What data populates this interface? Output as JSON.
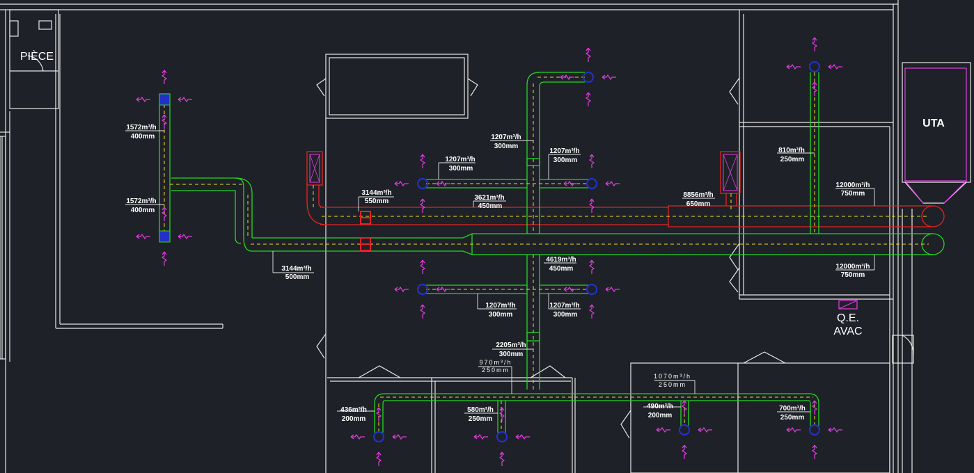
{
  "rooms": {
    "piece": "PIÈCE",
    "uta": "UTA",
    "qe_line1": "Q.E.",
    "qe_line2": "AVAC"
  },
  "labels": [
    {
      "flow": "1572m³/h",
      "size": "400mm"
    },
    {
      "flow": "1572m³/h",
      "size": "400mm"
    },
    {
      "flow": "1207m³/h",
      "size": "300mm"
    },
    {
      "flow": "1207m³/h",
      "size": "300mm"
    },
    {
      "flow": "1207m³/h",
      "size": "300mm"
    },
    {
      "flow": "3144m³/h",
      "size": "550mm"
    },
    {
      "flow": "3621m³/h",
      "size": "450mm"
    },
    {
      "flow": "8856m³/h",
      "size": "650mm"
    },
    {
      "flow": "810m³/h",
      "size": "250mm"
    },
    {
      "flow": "12000m³/h",
      "size": "750mm"
    },
    {
      "flow": "3144m³/h",
      "size": "500mm"
    },
    {
      "flow": "4619m³/h",
      "size": "450mm"
    },
    {
      "flow": "12000m³/h",
      "size": "750mm"
    },
    {
      "flow": "1207m³/h",
      "size": "300mm"
    },
    {
      "flow": "1207m³/h",
      "size": "300mm"
    },
    {
      "flow": "2205m³/h",
      "size": "300mm"
    },
    {
      "flow": "436m³/h",
      "size": "200mm"
    },
    {
      "flow": "580m³/h",
      "size": "250mm"
    },
    {
      "flow": "490m³/h",
      "size": "200mm"
    },
    {
      "flow": "700m³/h",
      "size": "250mm"
    }
  ],
  "small_labels": [
    {
      "flow": "970m³/h",
      "size": "250mm"
    },
    {
      "flow": "1070m³/h",
      "size": "250mm"
    }
  ],
  "colors": {
    "background": "#1e2127",
    "supply_duct": "#23d823",
    "extract_duct": "#e62323",
    "duct_axis": "#f0e020",
    "diffuser": "#2330c8",
    "airflow_arrow": "#e23de2",
    "walls": "#e8e8e8"
  }
}
